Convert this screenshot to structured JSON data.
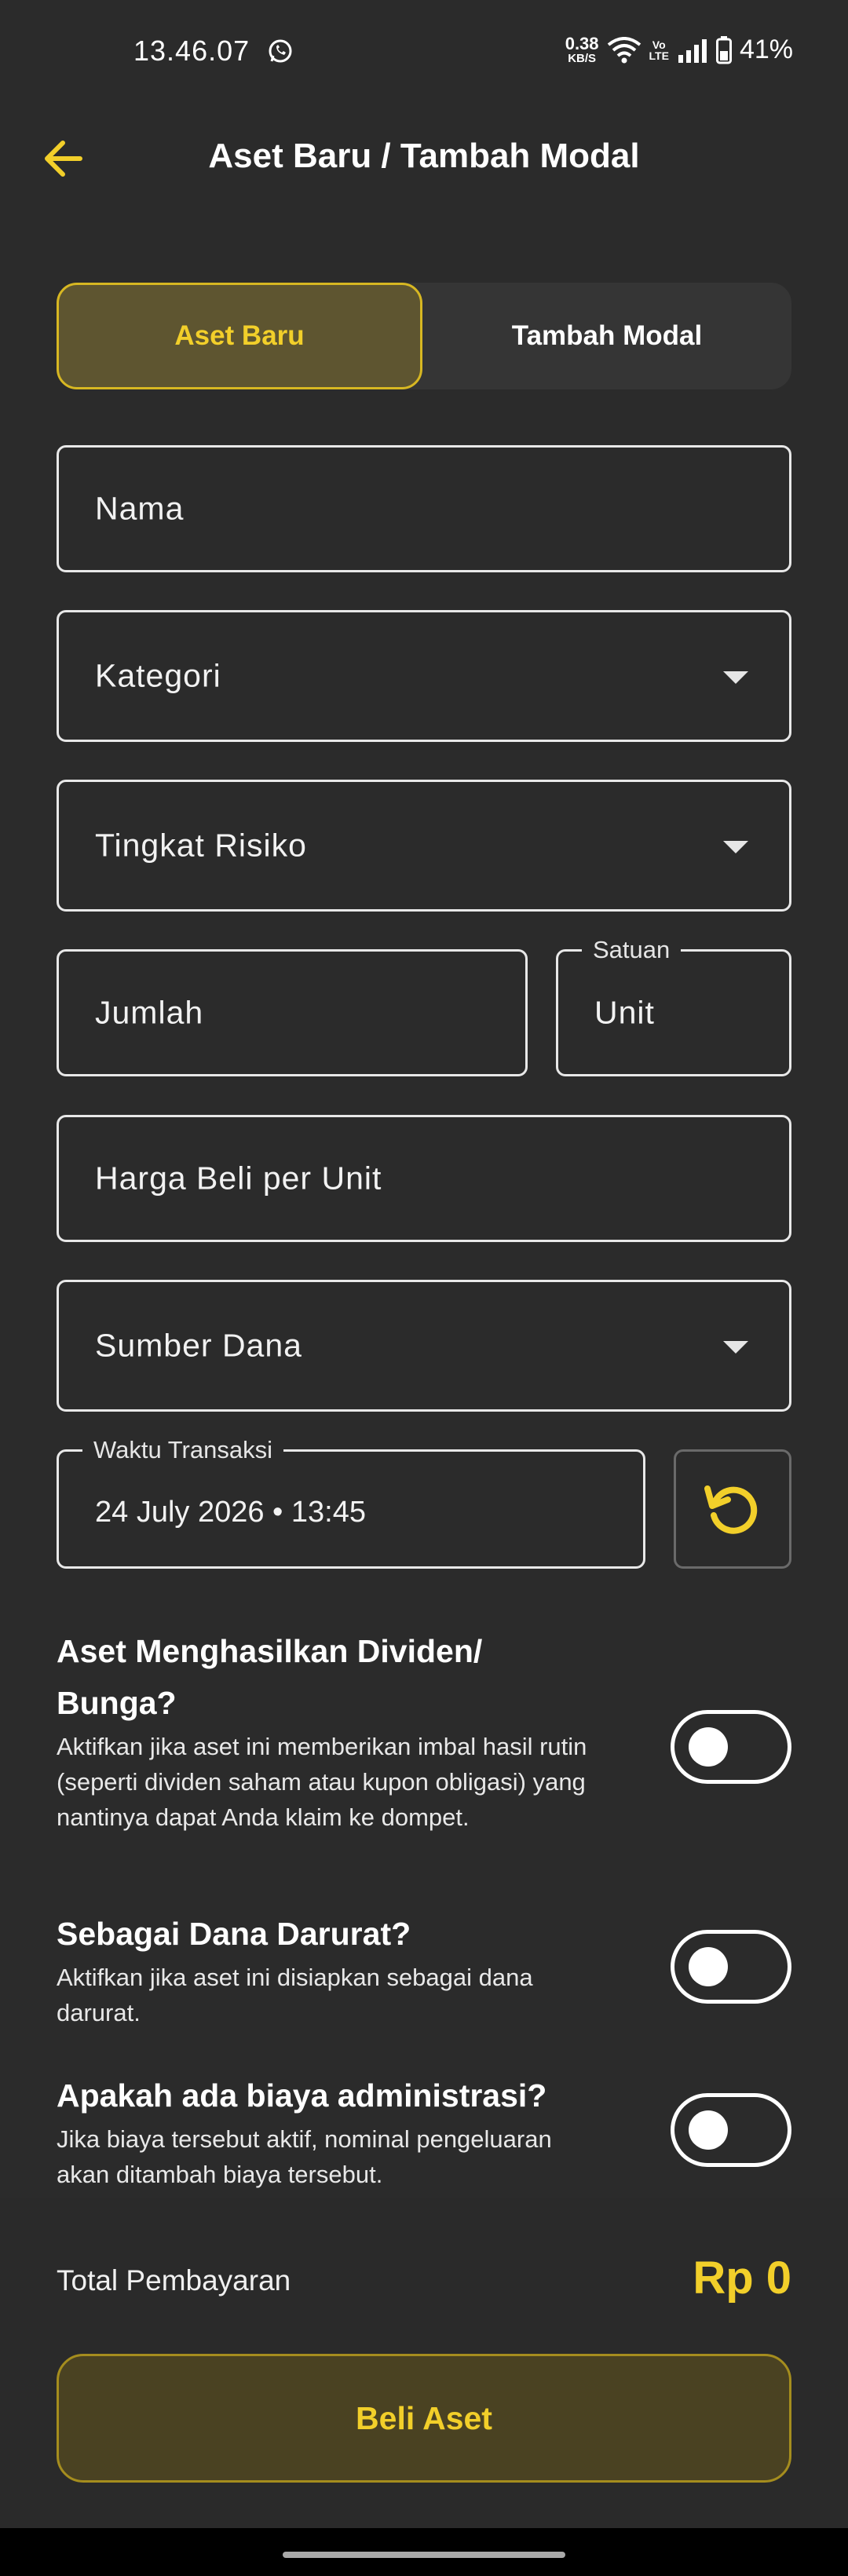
{
  "status_bar": {
    "time": "13.46.07",
    "net_speed_value": "0.38",
    "net_speed_unit": "KB/S",
    "volte_top": "Vo",
    "volte_bottom": "LTE",
    "battery": "41%",
    "icons": [
      "whatsapp-icon",
      "wifi-icon",
      "signal-icon",
      "battery-icon"
    ]
  },
  "header": {
    "title": "Aset Baru / Tambah Modal",
    "back_icon": "arrow-left-icon"
  },
  "segment": {
    "active": "Aset Baru",
    "inactive": "Tambah Modal"
  },
  "form": {
    "nama_placeholder": "Nama",
    "kategori_placeholder": "Kategori",
    "risiko_placeholder": "Tingkat Risiko",
    "jumlah_placeholder": "Jumlah",
    "satuan_label": "Satuan",
    "satuan_value": "Unit",
    "harga_placeholder": "Harga Beli per Unit",
    "sumber_placeholder": "Sumber Dana",
    "waktu_label": "Waktu Transaksi",
    "waktu_value": "24 July 2026 • 13:45",
    "reset_icon": "reset-time-icon"
  },
  "toggles": [
    {
      "title": "Aset Menghasilkan Dividen/ Bunga?",
      "desc": "Aktifkan jika aset ini memberikan imbal hasil rutin (seperti dividen saham atau kupon obligasi) yang nantinya dapat Anda klaim ke dompet.",
      "on": false
    },
    {
      "title": "Sebagai Dana Darurat?",
      "desc": "Aktifkan jika aset ini disiapkan sebagai dana darurat.",
      "on": false
    },
    {
      "title": "Apakah ada biaya administrasi?",
      "desc": "Jika biaya tersebut aktif, nominal pengeluaran akan ditambah biaya tersebut.",
      "on": false
    }
  ],
  "footer": {
    "total_label": "Total Pembayaran",
    "total_value": "Rp 0",
    "buy_label": "Beli Aset"
  },
  "colors": {
    "background": "#2b2b2b",
    "accent": "#f2cf2a",
    "accent_bg": "#5e5530"
  }
}
